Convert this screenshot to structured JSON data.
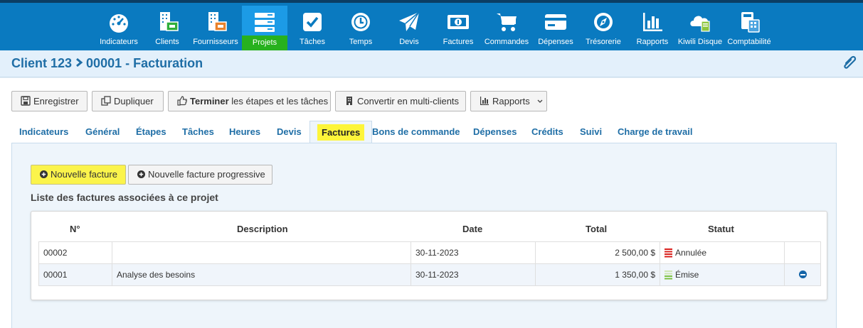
{
  "nav": {
    "items": [
      {
        "label": "Indicateurs",
        "icon": "dashboard-gauge-icon"
      },
      {
        "label": "Clients",
        "icon": "clients-building-icon"
      },
      {
        "label": "Fournisseurs",
        "icon": "suppliers-building-icon"
      },
      {
        "label": "Projets",
        "icon": "projects-stack-icon",
        "active": true
      },
      {
        "label": "Tâches",
        "icon": "tasks-checkbox-icon"
      },
      {
        "label": "Temps",
        "icon": "time-clock-icon"
      },
      {
        "label": "Devis",
        "icon": "quote-paper-plane-icon"
      },
      {
        "label": "Factures",
        "icon": "invoices-banknote-icon"
      },
      {
        "label": "Commandes",
        "icon": "orders-cart-icon"
      },
      {
        "label": "Dépenses",
        "icon": "expenses-card-icon"
      },
      {
        "label": "Trésorerie",
        "icon": "treasury-compass-icon"
      },
      {
        "label": "Rapports",
        "icon": "reports-bar-chart-icon"
      },
      {
        "label": "Kiwili Disque",
        "icon": "cloud-drive-icon"
      },
      {
        "label": "Comptabilité",
        "icon": "accounting-calculator-icon"
      }
    ],
    "colors": {
      "bar": "#0a7ac0",
      "active_bg": "#1c9be6",
      "active_label": "#27b11e"
    }
  },
  "header": {
    "client": "Client 123",
    "project": "00001 - Facturation",
    "attach_icon": "paperclip-icon"
  },
  "toolbar": {
    "save_label": "Enregistrer",
    "duplicate_label": "Dupliquer",
    "finish_bold": "Terminer",
    "finish_rest": " les étapes et les tâches",
    "convert_label": "Convertir en multi-clients",
    "reports_label": "Rapports"
  },
  "tabs": [
    {
      "label": "Indicateurs"
    },
    {
      "label": "Général"
    },
    {
      "label": "Étapes"
    },
    {
      "label": "Tâches"
    },
    {
      "label": "Heures"
    },
    {
      "label": "Devis"
    },
    {
      "label": "Factures",
      "active": true
    },
    {
      "label": "Bons de commande"
    },
    {
      "label": "Dépenses"
    },
    {
      "label": "Crédits"
    },
    {
      "label": "Suivi"
    },
    {
      "label": "Charge de travail"
    }
  ],
  "actions": {
    "new_invoice": "Nouvelle facture",
    "new_progressive": "Nouvelle facture progressive"
  },
  "section": {
    "title": "Liste des factures associées à ce projet"
  },
  "table": {
    "headers": {
      "number": "N°",
      "description": "Description",
      "date": "Date",
      "total": "Total",
      "status": "Statut"
    },
    "rows": [
      {
        "number": "00002",
        "description": "",
        "date": "30-11-2023",
        "total": "2 500,00 $",
        "status": "Annulée",
        "status_color": "#d9211e"
      },
      {
        "number": "00001",
        "description": "Analyse des besoins",
        "date": "30-11-2023",
        "total": "1 350,00 $",
        "status": "Émise",
        "status_color": "#7dc243"
      }
    ]
  },
  "highlight_color": "#fdf53a"
}
